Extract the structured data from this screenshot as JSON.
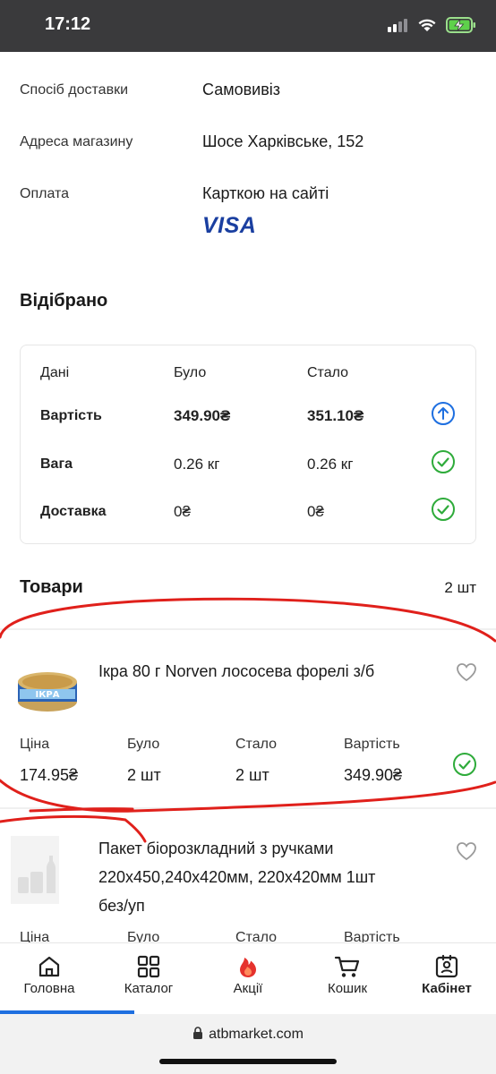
{
  "status": {
    "time": "17:12"
  },
  "order": {
    "delivery_label": "Спосіб доставки",
    "delivery_value": "Самовивіз",
    "address_label": "Адреса магазину",
    "address_value": "Шосе Харківське, 152",
    "payment_label": "Оплата",
    "payment_value": "Карткою на сайті",
    "payment_brand": "VISA"
  },
  "selected": {
    "title": "Відібрано",
    "headers": [
      "Дані",
      "Було",
      "Стало"
    ],
    "rows": [
      {
        "label": "Вартість",
        "before": "349.90₴",
        "after": "351.10₴",
        "status": "arrow-up-icon"
      },
      {
        "label": "Вага",
        "before": "0.26 кг",
        "after": "0.26 кг",
        "status": "check-icon"
      },
      {
        "label": "Доставка",
        "before": "0₴",
        "after": "0₴",
        "status": "check-icon"
      }
    ]
  },
  "goods": {
    "title": "Товари",
    "count": "2 шт",
    "col_headers": [
      "Ціна",
      "Було",
      "Стало",
      "Вартість"
    ],
    "items": [
      {
        "name": "Ікра 80 г Norven лососева форелі з/б",
        "image_text": "ІКРА",
        "price": "174.95₴",
        "before": "2 шт",
        "after": "2 шт",
        "total": "349.90₴"
      },
      {
        "name_lines": [
          "Пакет біорозкладний з ручками",
          "220x450,240x420мм, 220x420мм 1шт",
          "без/уп"
        ]
      }
    ]
  },
  "nav": {
    "items": [
      {
        "label": "Головна",
        "icon": "home-icon"
      },
      {
        "label": "Каталог",
        "icon": "grid-icon"
      },
      {
        "label": "Акції",
        "icon": "fire-icon"
      },
      {
        "label": "Кошик",
        "icon": "cart-icon"
      },
      {
        "label": "Кабінет",
        "icon": "profile-icon"
      }
    ]
  },
  "browser": {
    "url": "atbmarket.com"
  },
  "colors": {
    "accent_blue": "#1e6fe0",
    "check_green": "#2eab3a",
    "fire_red": "#e5322d",
    "annotation_red": "#e0201b"
  }
}
